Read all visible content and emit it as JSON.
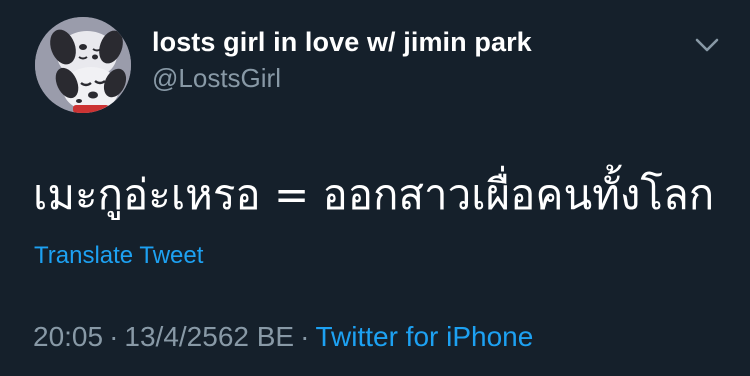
{
  "author": {
    "display_name": "losts girl in love w/ jimin park",
    "handle": "@LostsGirl",
    "avatar_icon": "dalmatian-cartoon-avatar"
  },
  "tweet": {
    "text": "เมะกูอ่ะเหรอ = ออกสาวเผื่อคนทั้งโลก",
    "translate_label": "Translate Tweet"
  },
  "meta": {
    "time": "20:05",
    "date": "13/4/2562 BE",
    "separator": "·",
    "source": "Twitter for iPhone"
  },
  "icons": {
    "more": "chevron-down-icon"
  },
  "colors": {
    "background": "#15202b",
    "accent": "#1da1f2",
    "secondary_text": "#8899a6",
    "primary_text": "#ffffff"
  }
}
